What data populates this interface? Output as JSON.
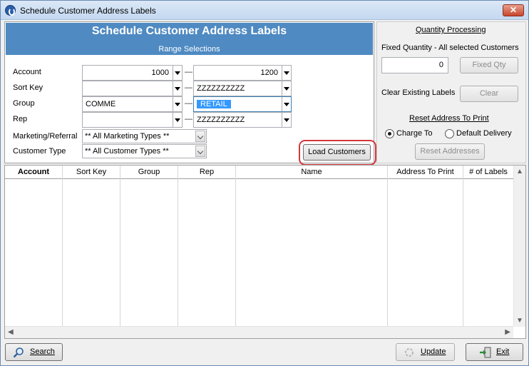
{
  "window": {
    "title": "Schedule Customer Address Labels",
    "close_glyph": "✕"
  },
  "header": {
    "title": "Schedule Customer Address Labels",
    "subtitle": "Range Selections"
  },
  "range": {
    "account": {
      "label": "Account",
      "from": "1000",
      "to": "1200"
    },
    "sort_key": {
      "label": "Sort Key",
      "from": "",
      "to": "ZZZZZZZZZZ"
    },
    "group": {
      "label": "Group",
      "from": "COMME",
      "to": "RETAIL"
    },
    "rep": {
      "label": "Rep",
      "from": "",
      "to": "ZZZZZZZZZZ"
    },
    "dash": "—"
  },
  "marketing": {
    "label": "Marketing/Referral",
    "value": "** All Marketing Types **"
  },
  "customer_type": {
    "label": "Customer Type",
    "value": "** All Customer Types **"
  },
  "load_button": "Load Customers",
  "quantity": {
    "title": "Quantity Processing",
    "fixed_label": "Fixed Quantity - All selected Customers",
    "fixed_value": "0",
    "fixed_button": "Fixed Qty",
    "clear_label": "Clear Existing Labels",
    "clear_button": "Clear"
  },
  "reset": {
    "title": "Reset Address To Print",
    "option_charge": "Charge To",
    "option_default": "Default Delivery",
    "selected": "charge",
    "button": "Reset Addresses"
  },
  "grid": {
    "columns": [
      "Account",
      "Sort Key",
      "Group",
      "Rep",
      "Name",
      "Address To Print",
      "# of Labels"
    ],
    "rows": []
  },
  "footer": {
    "search": "Search",
    "update": "Update",
    "exit": "Exit"
  },
  "colors": {
    "header_band": "#4f8ac2",
    "highlight_ring": "#d2383c",
    "selection": "#3399ff"
  }
}
